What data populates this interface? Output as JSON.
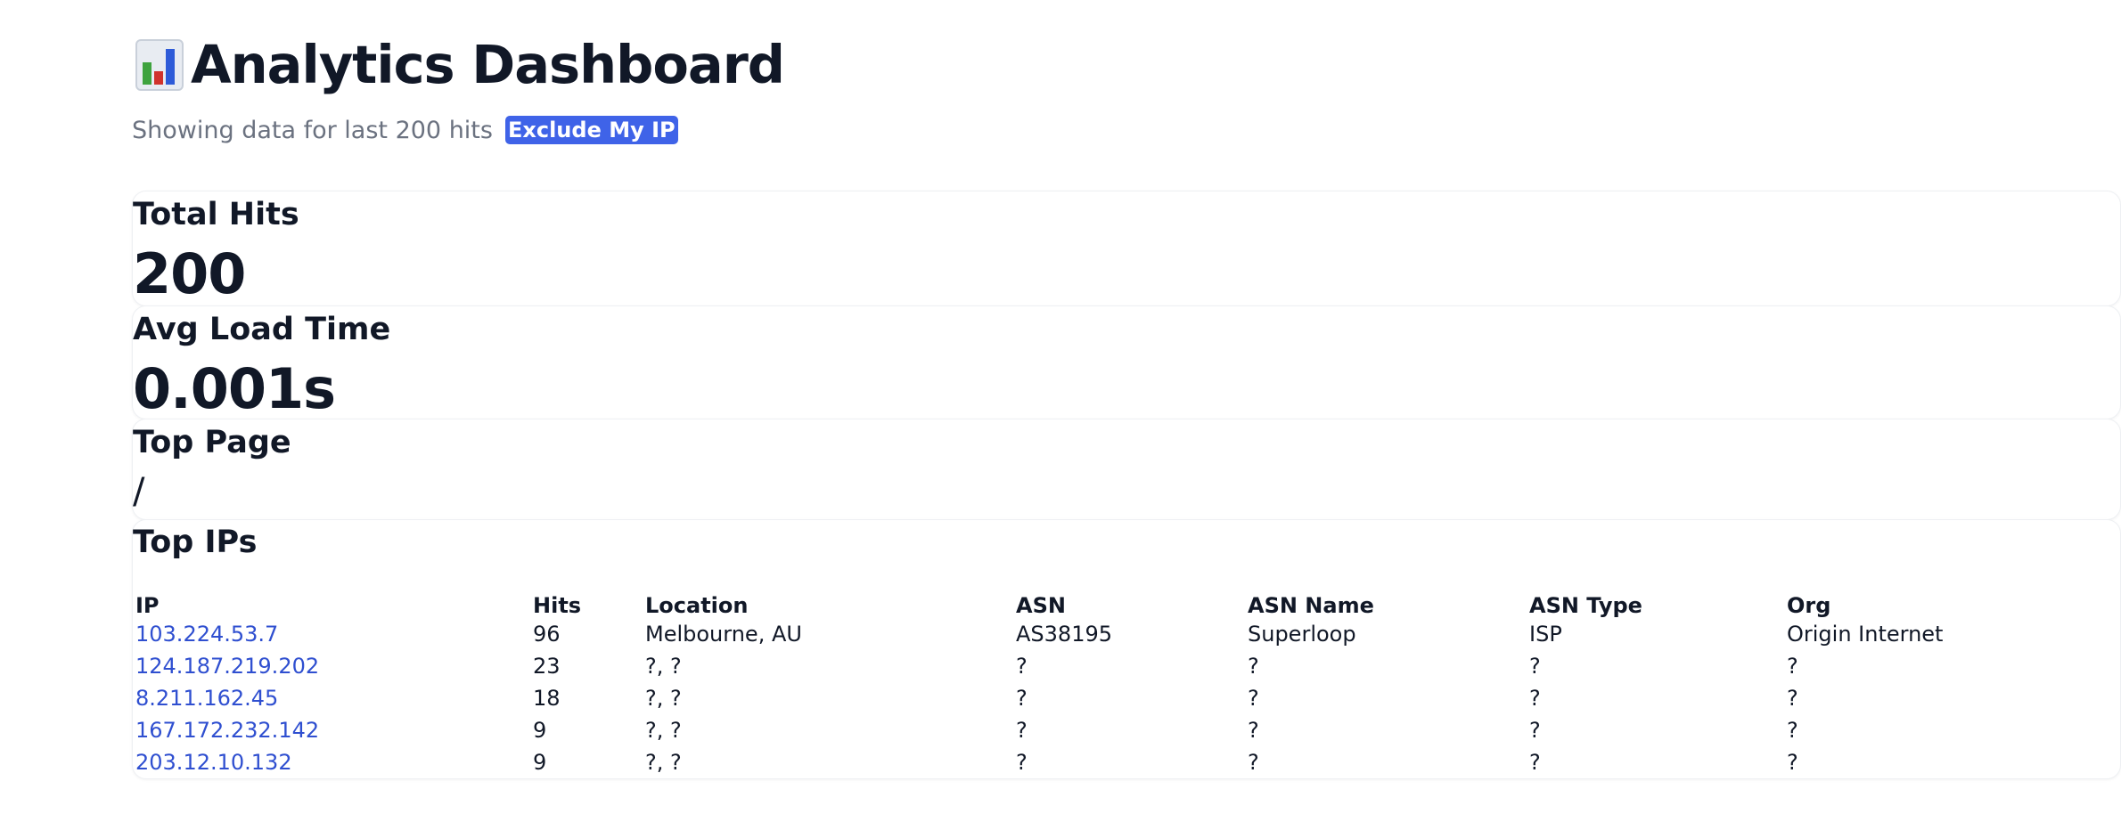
{
  "header": {
    "title": "Analytics Dashboard",
    "icon": "bar-chart-icon",
    "subtitle": "Showing data for last 200 hits",
    "exclude_button_label": "Exclude My IP"
  },
  "stats": {
    "total_hits": {
      "label": "Total Hits",
      "value": "200"
    },
    "avg_load_time": {
      "label": "Avg Load Time",
      "value": "0.001s"
    },
    "top_page": {
      "label": "Top Page",
      "value": "/"
    }
  },
  "top_ips": {
    "title": "Top IPs",
    "columns": [
      "IP",
      "Hits",
      "Location",
      "ASN",
      "ASN Name",
      "ASN Type",
      "Org"
    ],
    "rows": [
      {
        "ip": "103.224.53.7",
        "hits": "96",
        "location": "Melbourne, AU",
        "asn": "AS38195",
        "asn_name": "Superloop",
        "asn_type": "ISP",
        "org": "Origin Internet"
      },
      {
        "ip": "124.187.219.202",
        "hits": "23",
        "location": "?, ?",
        "asn": "?",
        "asn_name": "?",
        "asn_type": "?",
        "org": "?"
      },
      {
        "ip": "8.211.162.45",
        "hits": "18",
        "location": "?, ?",
        "asn": "?",
        "asn_name": "?",
        "asn_type": "?",
        "org": "?"
      },
      {
        "ip": "167.172.232.142",
        "hits": "9",
        "location": "?, ?",
        "asn": "?",
        "asn_name": "?",
        "asn_type": "?",
        "org": "?"
      },
      {
        "ip": "203.12.10.132",
        "hits": "9",
        "location": "?, ?",
        "asn": "?",
        "asn_name": "?",
        "asn_type": "?",
        "org": "?"
      }
    ]
  },
  "colors": {
    "accent": "#3f63e8",
    "link": "#2f4fd0",
    "text": "#111827",
    "muted": "#6b7280"
  }
}
